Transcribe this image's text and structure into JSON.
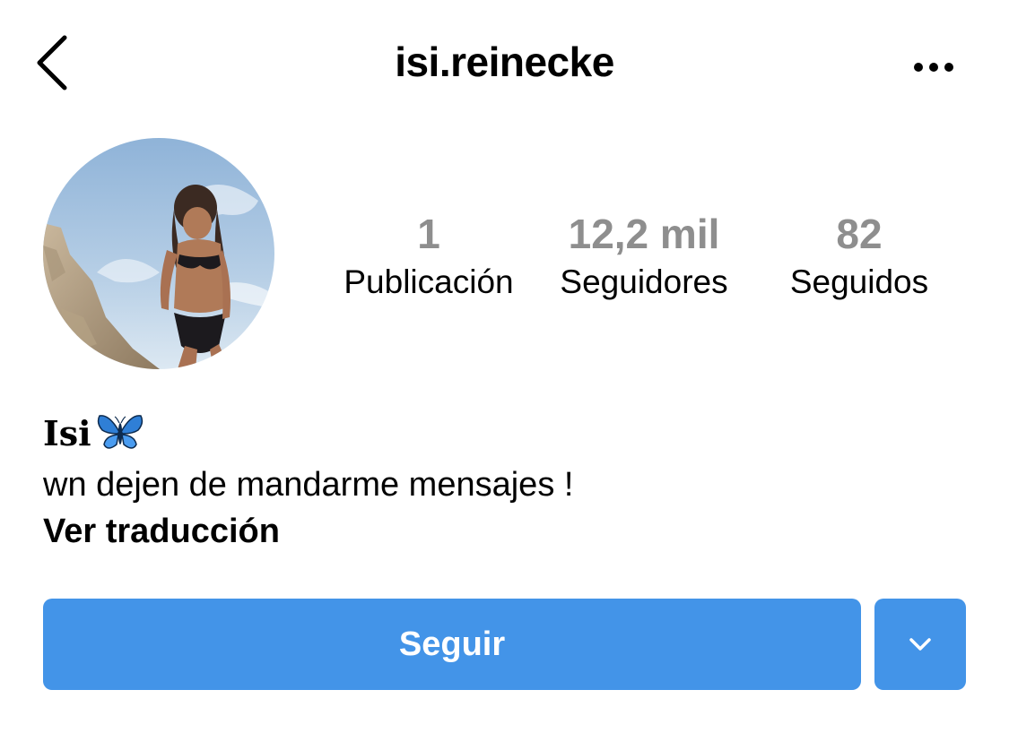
{
  "header": {
    "username": "isi.reinecke",
    "back_icon": "chevron-left-icon",
    "more_icon": "more-horizontal-icon"
  },
  "profile": {
    "avatar": "profile-photo"
  },
  "stats": {
    "posts": {
      "count": "1",
      "label": "Publicación"
    },
    "followers": {
      "count": "12,2 mil",
      "label": "Seguidores"
    },
    "following": {
      "count": "82",
      "label": "Seguidos"
    }
  },
  "bio": {
    "display_name": "Isi",
    "emoji_icon": "butterfly-icon",
    "text": "wn dejen de mandarme mensajes !",
    "translate_label": "Ver traducción"
  },
  "actions": {
    "follow_label": "Seguir",
    "dropdown_icon": "chevron-down-icon"
  },
  "colors": {
    "primary": "#4394e8",
    "muted_text": "#8e8e8e",
    "background": "#ffffff"
  }
}
